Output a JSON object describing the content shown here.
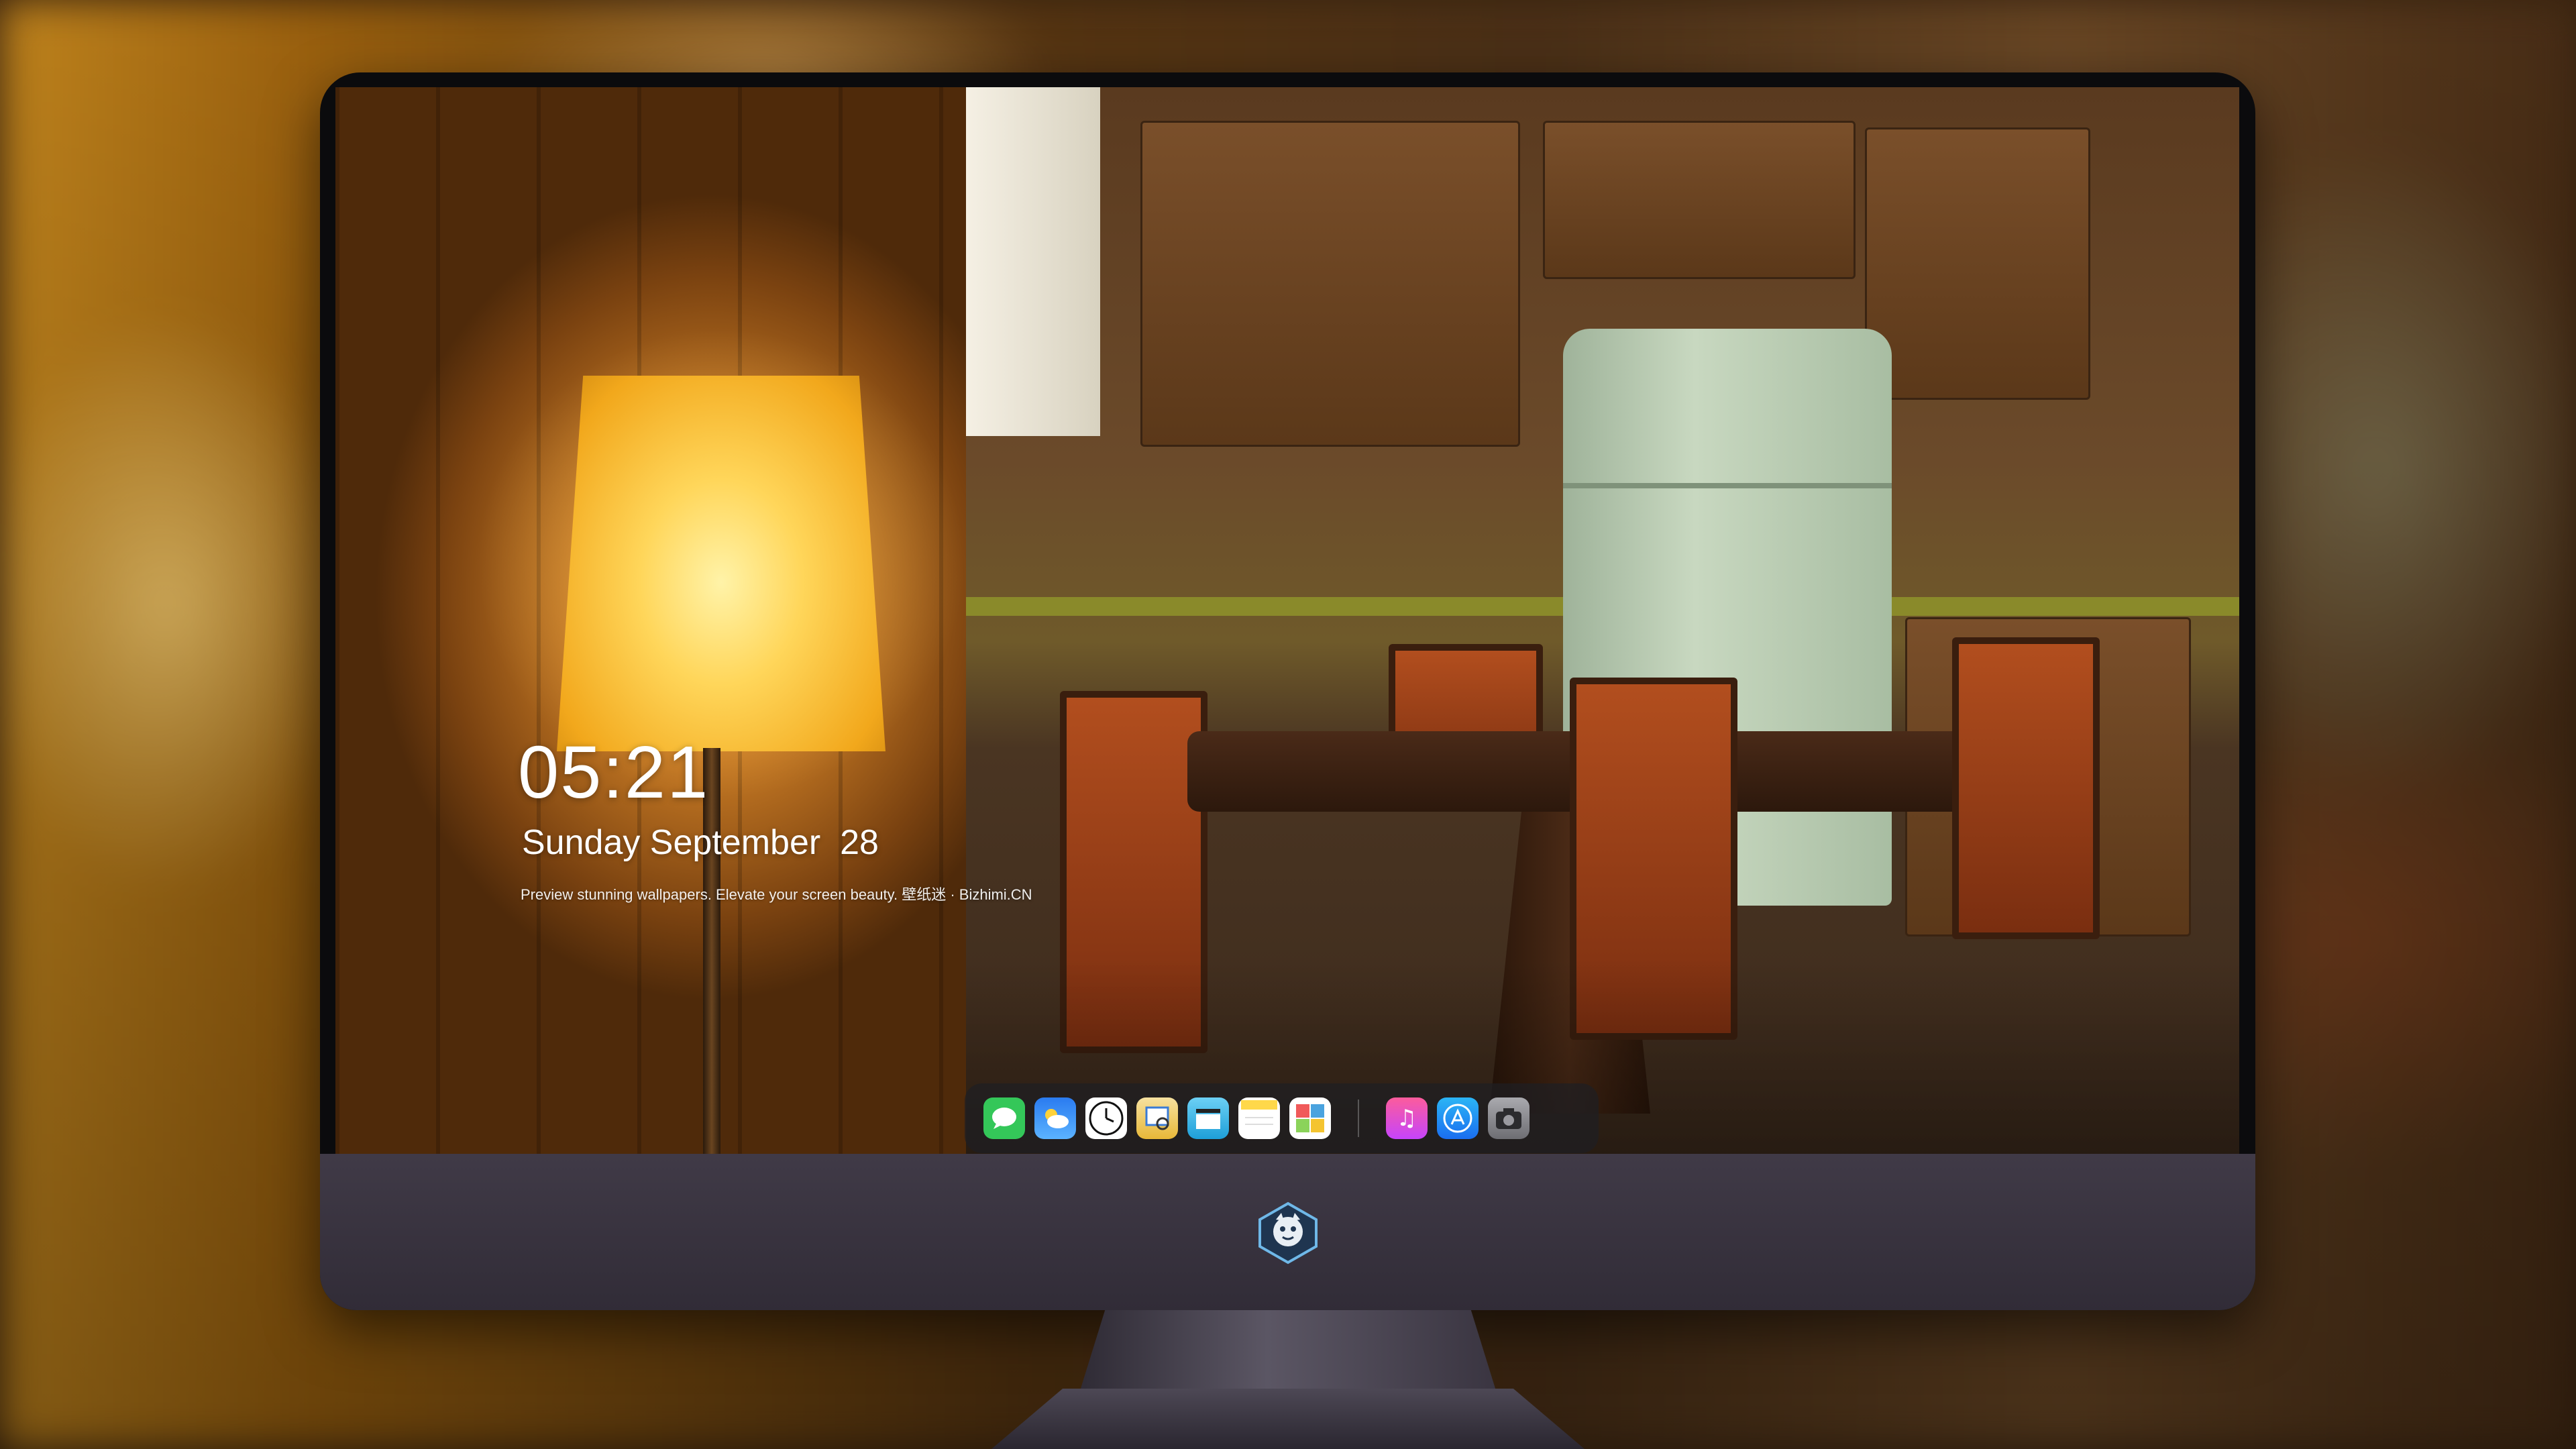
{
  "lockscreen": {
    "time": "05:21",
    "date": "Sunday September  28",
    "caption": "Preview stunning wallpapers. Elevate your screen beauty. 壁纸迷 · Bizhimi.CN"
  },
  "dock": {
    "apps": [
      {
        "icon": "messages-icon",
        "color": "#34c759"
      },
      {
        "icon": "weather-icon",
        "color": "#2f8df5"
      },
      {
        "icon": "clock-icon",
        "color": "#ffffff"
      },
      {
        "icon": "preview-icon",
        "color": "#f2c230"
      },
      {
        "icon": "clips-icon",
        "color": "#38b3e8"
      },
      {
        "icon": "notes-icon",
        "color": "#ffd84a"
      },
      {
        "icon": "photo-booth-icon",
        "color": "#4aa3df"
      },
      {
        "icon": "music-icon",
        "color": "#fc3c8d"
      },
      {
        "icon": "app-store-icon",
        "color": "#1e8cf0"
      },
      {
        "icon": "camera-icon",
        "color": "#8e8e93"
      }
    ]
  },
  "brand": {
    "logo": "mascot-logo-icon"
  }
}
